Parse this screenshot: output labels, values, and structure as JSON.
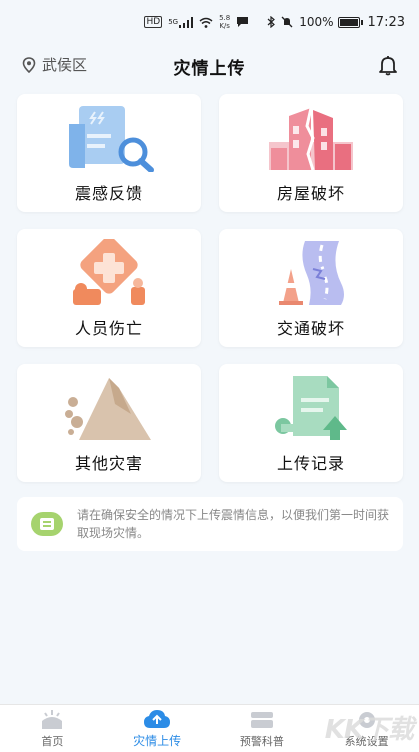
{
  "status_bar": {
    "hd_label": "HD",
    "signal_label": "5G",
    "speed_value": "5.8",
    "speed_unit": "K/s",
    "battery_percent": "100%",
    "time": "17:23"
  },
  "header": {
    "location": "武侯区",
    "title": "灾情上传"
  },
  "cards": [
    {
      "label": "震感反馈",
      "icon": "seismic-feedback-icon"
    },
    {
      "label": "房屋破坏",
      "icon": "house-damage-icon"
    },
    {
      "label": "人员伤亡",
      "icon": "casualty-icon"
    },
    {
      "label": "交通破坏",
      "icon": "traffic-damage-icon"
    },
    {
      "label": "其他灾害",
      "icon": "landslide-icon"
    },
    {
      "label": "上传记录",
      "icon": "upload-record-icon"
    }
  ],
  "notice": {
    "text": "请在确保安全的情况下上传震情信息，以便我们第一时间获取现场灾情。"
  },
  "tabbar": {
    "items": [
      {
        "label": "首页",
        "active": false
      },
      {
        "label": "灾情上传",
        "active": true
      },
      {
        "label": "预警科普",
        "active": false
      },
      {
        "label": "系统设置",
        "active": false
      }
    ]
  },
  "watermark": "KK下载",
  "colors": {
    "accent": "#2c8ce6",
    "background": "#f3f7fb"
  }
}
